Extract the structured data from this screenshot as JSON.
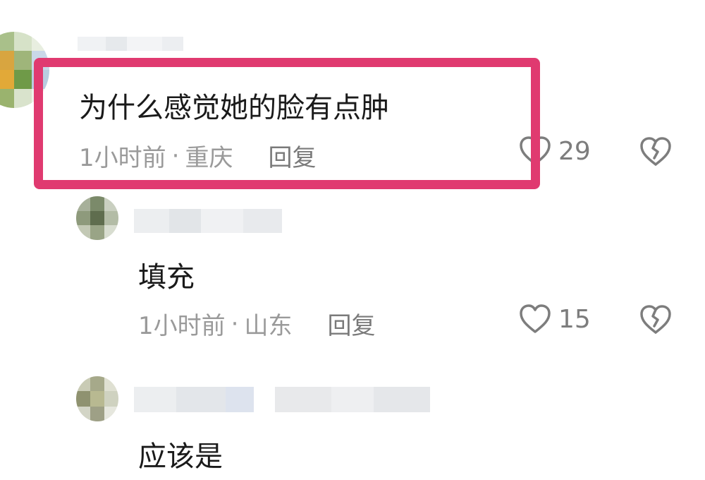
{
  "comments": [
    {
      "text": "为什么感觉她的脸有点肿",
      "time": "1小时前",
      "location": "重庆",
      "reply_label": "回复",
      "likes": "29"
    },
    {
      "text": "填充",
      "time": "1小时前",
      "location": "山东",
      "reply_label": "回复",
      "likes": "15"
    },
    {
      "text": "应该是"
    }
  ],
  "separator": "·",
  "colors": {
    "highlight": "#e03a70",
    "text": "#1a1a1a",
    "meta": "#9a9a9a"
  },
  "icons": {
    "like": "heart-outline-icon",
    "dislike": "broken-heart-icon"
  }
}
